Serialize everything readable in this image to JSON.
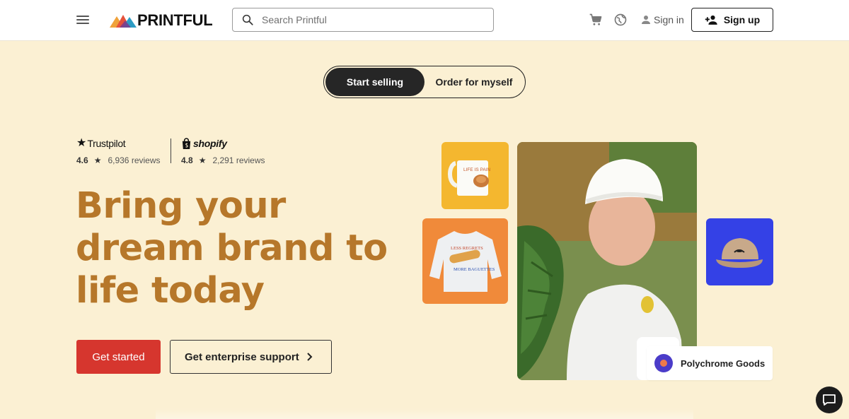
{
  "header": {
    "logo_text": "PRINTFUL",
    "search_placeholder": "Search Printful",
    "signin_label": "Sign in",
    "signup_label": "Sign up"
  },
  "toggle": {
    "active_label": "Start selling",
    "inactive_label": "Order for myself"
  },
  "ratings": {
    "trustpilot": {
      "brand": "Trustpilot",
      "score": "4.6",
      "reviews": "6,936 reviews"
    },
    "shopify": {
      "brand": "shopify",
      "score": "4.8",
      "reviews": "2,291 reviews"
    }
  },
  "hero": {
    "headline_lines": [
      "Bring your",
      "dream brand to",
      "life today"
    ],
    "primary_cta": "Get started",
    "secondary_cta": "Get enterprise support"
  },
  "collage": {
    "mug_text": "LIFE IS PAIN",
    "sweat_text_1": "LESS REGRETS",
    "sweat_text_2": "MORE BAGUETTES",
    "brand_badge": "Polychrome Goods"
  },
  "colors": {
    "page_bg": "#fbf0d3",
    "headline": "#b6772a",
    "primary_cta": "#d6362e",
    "toggle_active": "#262626"
  },
  "icons": [
    "menu-icon",
    "search-icon",
    "cart-icon",
    "globe-icon",
    "person-icon",
    "person-add-icon",
    "star-icon",
    "shopify-bag-icon",
    "chevron-right-icon",
    "chat-icon"
  ]
}
